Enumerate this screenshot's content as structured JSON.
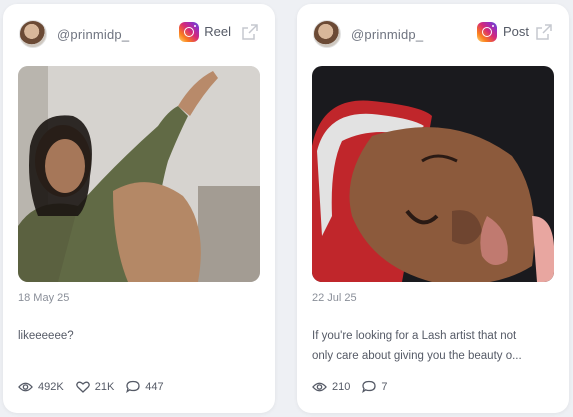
{
  "cards": [
    {
      "username": "@prinmidp_",
      "type_label": "Reel",
      "date": "18 May 25",
      "caption": "likeeeeee?",
      "stats": {
        "views": "492K",
        "likes": "21K",
        "comments": "447"
      },
      "icons": [
        "instagram-icon",
        "external-link-icon",
        "eye-icon",
        "heart-icon",
        "comment-icon"
      ]
    },
    {
      "username": "@prinmidp_",
      "type_label": "Post",
      "date": "22 Jul 25",
      "caption_line1": "If you're looking for a Lash artist that not",
      "caption_line2": "only care about giving you the beauty o...",
      "stats": {
        "views": "210",
        "comments": "7"
      },
      "icons": [
        "instagram-icon",
        "external-link-icon",
        "eye-icon",
        "comment-icon"
      ]
    }
  ],
  "colors": {
    "background": "#eef0f4",
    "card": "#ffffff",
    "muted_text": "#8a8f99",
    "text": "#555a66"
  }
}
